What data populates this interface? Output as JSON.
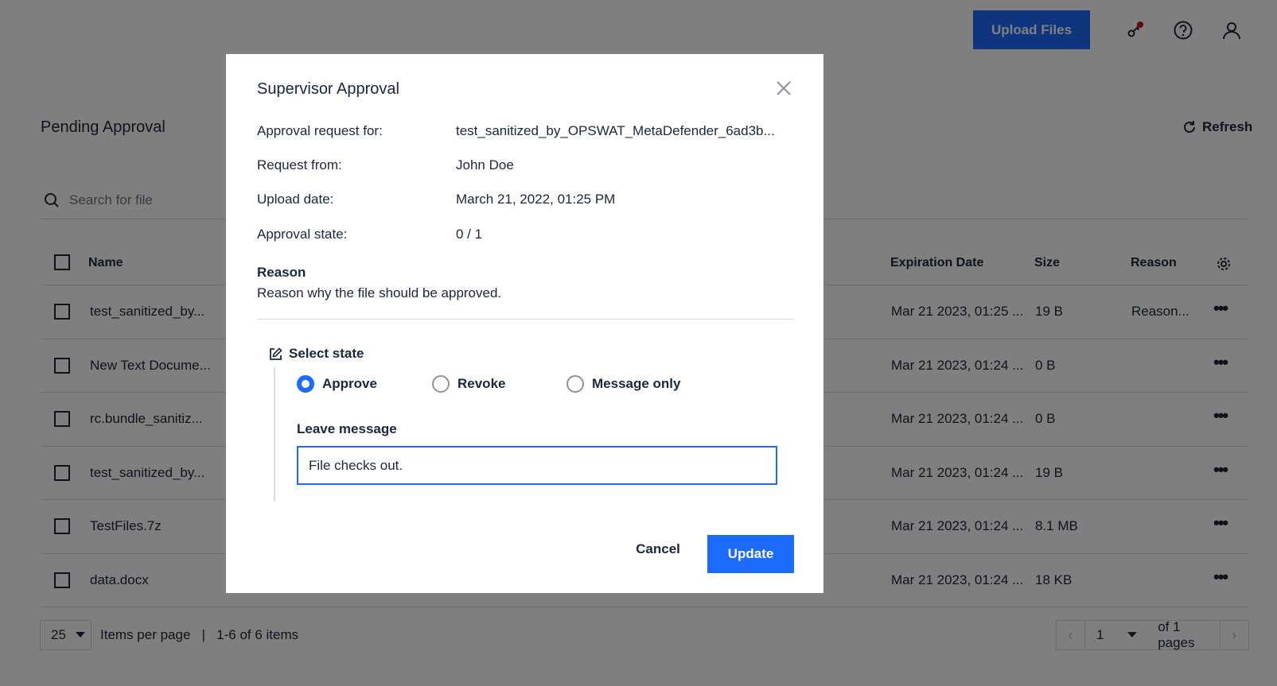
{
  "header": {
    "upload_label": "Upload Files",
    "icons": [
      "key-icon",
      "help-icon",
      "user-icon"
    ]
  },
  "page": {
    "title": "Pending Approval",
    "refresh_label": "Refresh",
    "search_placeholder": "Search for file"
  },
  "table": {
    "headers": {
      "name": "Name",
      "expiration": "Expiration Date",
      "size": "Size",
      "reason": "Reason"
    },
    "rows": [
      {
        "name": "test_sanitized_by...",
        "expiration": "Mar 21 2023, 01:25 ...",
        "size": "19 B",
        "reason": "Reason..."
      },
      {
        "name": "New Text Docume...",
        "expiration": "Mar 21 2023, 01:24 ...",
        "size": "0 B",
        "reason": ""
      },
      {
        "name": "rc.bundle_sanitiz...",
        "expiration": "Mar 21 2023, 01:24 ...",
        "size": "0 B",
        "reason": ""
      },
      {
        "name": "test_sanitized_by...",
        "expiration": "Mar 21 2023, 01:24 ...",
        "size": "19 B",
        "reason": ""
      },
      {
        "name": "TestFiles.7z",
        "expiration": "Mar 21 2023, 01:24 ...",
        "size": "8.1 MB",
        "reason": ""
      },
      {
        "name": "data.docx",
        "expiration": "Mar 21 2023, 01:24 ...",
        "size": "18 KB",
        "reason": ""
      }
    ],
    "more_label": "•••"
  },
  "footer": {
    "per_page_value": "25",
    "per_page_text": "Items per page   |   1-6 of 6 items",
    "current_page": "1",
    "pages_text": "of 1 pages"
  },
  "modal": {
    "title": "Supervisor Approval",
    "fields": [
      {
        "label": "Approval request for:",
        "value": "test_sanitized_by_OPSWAT_MetaDefender_6ad3b..."
      },
      {
        "label": "Request from:",
        "value": "John Doe"
      },
      {
        "label": "Upload date:",
        "value": "March 21, 2022, 01:25 PM"
      },
      {
        "label": "Approval state:",
        "value": "0 / 1"
      }
    ],
    "reason_title": "Reason",
    "reason_text": "Reason why the file should be approved.",
    "select_state_label": "Select state",
    "options": [
      {
        "label": "Approve",
        "selected": true
      },
      {
        "label": "Revoke",
        "selected": false
      },
      {
        "label": "Message only",
        "selected": false
      }
    ],
    "message_label": "Leave message",
    "message_value": "File checks out.",
    "cancel_label": "Cancel",
    "update_label": "Update"
  },
  "colors": {
    "accent": "#1d6bfc",
    "text": "#1b273c",
    "notification_dot": "#c0111f"
  }
}
